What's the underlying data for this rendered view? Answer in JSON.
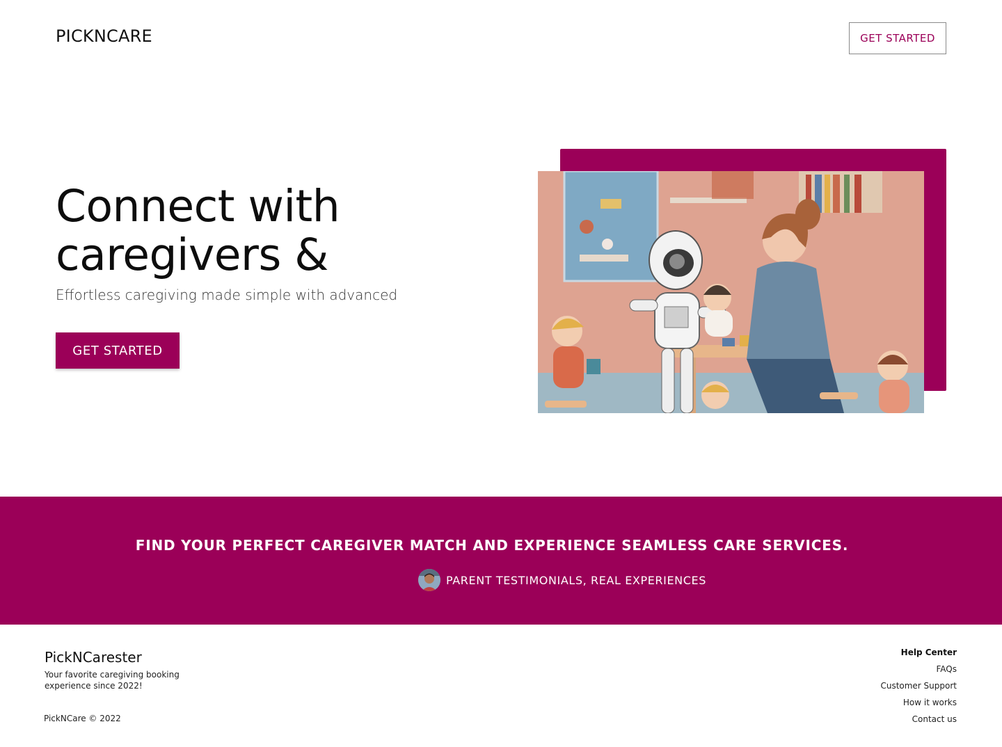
{
  "header": {
    "logo": "PICKNCARE",
    "cta_label": "GET STARTED"
  },
  "hero": {
    "title": "Connect with caregivers &",
    "subtitle": "Effortless caregiving made simple with advanced",
    "cta_label": "GET STARTED",
    "illustration": "robot-and-mother-caring-for-children-illustration"
  },
  "band": {
    "title": "FIND YOUR PERFECT CAREGIVER MATCH AND EXPERIENCE SEAMLESS CARE SERVICES.",
    "testimonial_label": "PARENT TESTIMONIALS, REAL EXPERIENCES"
  },
  "footer": {
    "brand": "PickNCarester",
    "tagline": "Your favorite caregiving booking experience since 2022!",
    "copyright": "PickNCare © 2022",
    "links_heading": "Help Center",
    "links": [
      "FAQs",
      "Customer Support",
      "How it works",
      "Contact us"
    ]
  },
  "colors": {
    "brand": "#9b0058",
    "background": "#ffffff",
    "text": "#111111"
  }
}
